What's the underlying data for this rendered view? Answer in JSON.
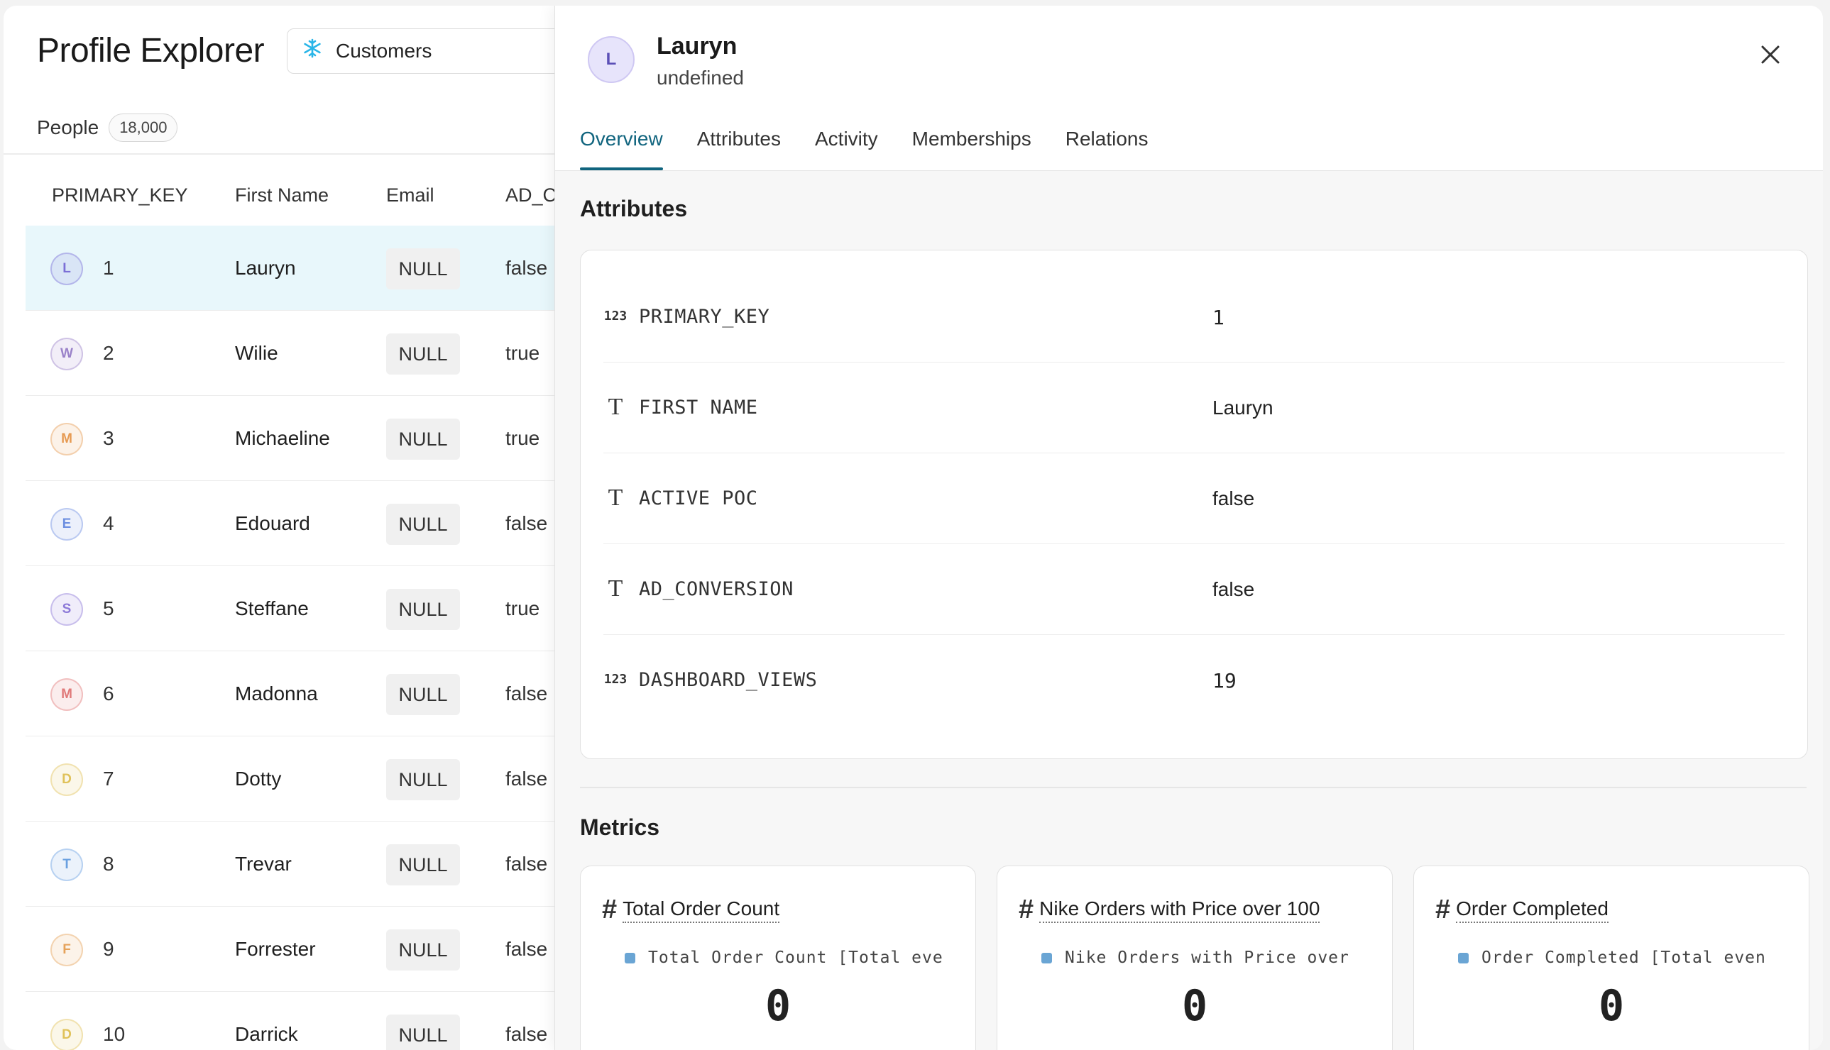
{
  "header": {
    "title": "Profile Explorer",
    "source": {
      "label": "Customers",
      "icon": "snowflake-icon",
      "color": "#29b5e8"
    }
  },
  "people": {
    "label": "People",
    "count": "18,000"
  },
  "table": {
    "columns": [
      "PRIMARY_KEY",
      "First Name",
      "Email",
      "AD_C"
    ],
    "rows": [
      {
        "initial": "L",
        "pk": "1",
        "first_name": "Lauryn",
        "email": "NULL",
        "ad_conversion": "false",
        "color": "#7b6fd6"
      },
      {
        "initial": "W",
        "pk": "2",
        "first_name": "Wilie",
        "email": "NULL",
        "ad_conversion": "true",
        "color": "#9a82c9"
      },
      {
        "initial": "M",
        "pk": "3",
        "first_name": "Michaeline",
        "email": "NULL",
        "ad_conversion": "true",
        "color": "#e69a52"
      },
      {
        "initial": "E",
        "pk": "4",
        "first_name": "Edouard",
        "email": "NULL",
        "ad_conversion": "false",
        "color": "#6d8fe0"
      },
      {
        "initial": "S",
        "pk": "5",
        "first_name": "Steffane",
        "email": "NULL",
        "ad_conversion": "true",
        "color": "#8c79d8"
      },
      {
        "initial": "M",
        "pk": "6",
        "first_name": "Madonna",
        "email": "NULL",
        "ad_conversion": "false",
        "color": "#e07a7a"
      },
      {
        "initial": "D",
        "pk": "7",
        "first_name": "Dotty",
        "email": "NULL",
        "ad_conversion": "false",
        "color": "#e0c25a"
      },
      {
        "initial": "T",
        "pk": "8",
        "first_name": "Trevar",
        "email": "NULL",
        "ad_conversion": "false",
        "color": "#6aa0e0"
      },
      {
        "initial": "F",
        "pk": "9",
        "first_name": "Forrester",
        "email": "NULL",
        "ad_conversion": "false",
        "color": "#e6a25a"
      },
      {
        "initial": "D",
        "pk": "10",
        "first_name": "Darrick",
        "email": "NULL",
        "ad_conversion": "false",
        "color": "#e0c25a"
      }
    ]
  },
  "profile": {
    "initial": "L",
    "name": "Lauryn",
    "subtitle": "undefined",
    "tabs": [
      "Overview",
      "Attributes",
      "Activity",
      "Memberships",
      "Relations"
    ],
    "active_tab": "Overview"
  },
  "attributes": {
    "title": "Attributes",
    "items": [
      {
        "type": "123",
        "key": "PRIMARY_KEY",
        "value": "1"
      },
      {
        "type": "T",
        "key": "FIRST NAME",
        "value": "Lauryn"
      },
      {
        "type": "T",
        "key": "ACTIVE POC",
        "value": "false"
      },
      {
        "type": "T",
        "key": "AD_CONVERSION",
        "value": "false"
      },
      {
        "type": "123",
        "key": "DASHBOARD_VIEWS",
        "value": "19"
      }
    ]
  },
  "metrics": {
    "title": "Metrics",
    "items": [
      {
        "title": "Total Order Count",
        "legend": "Total Order Count [Total eve",
        "value": "0"
      },
      {
        "title": "Nike Orders with Price over 100",
        "legend": "Nike Orders with Price over",
        "value": "0"
      },
      {
        "title": "Order Completed",
        "legend": "Order Completed [Total even",
        "value": "0"
      }
    ]
  },
  "colors": {
    "accent": "#10647e",
    "selected_row": "#e8f7fb",
    "legend_swatch": "#6aa5d4"
  }
}
